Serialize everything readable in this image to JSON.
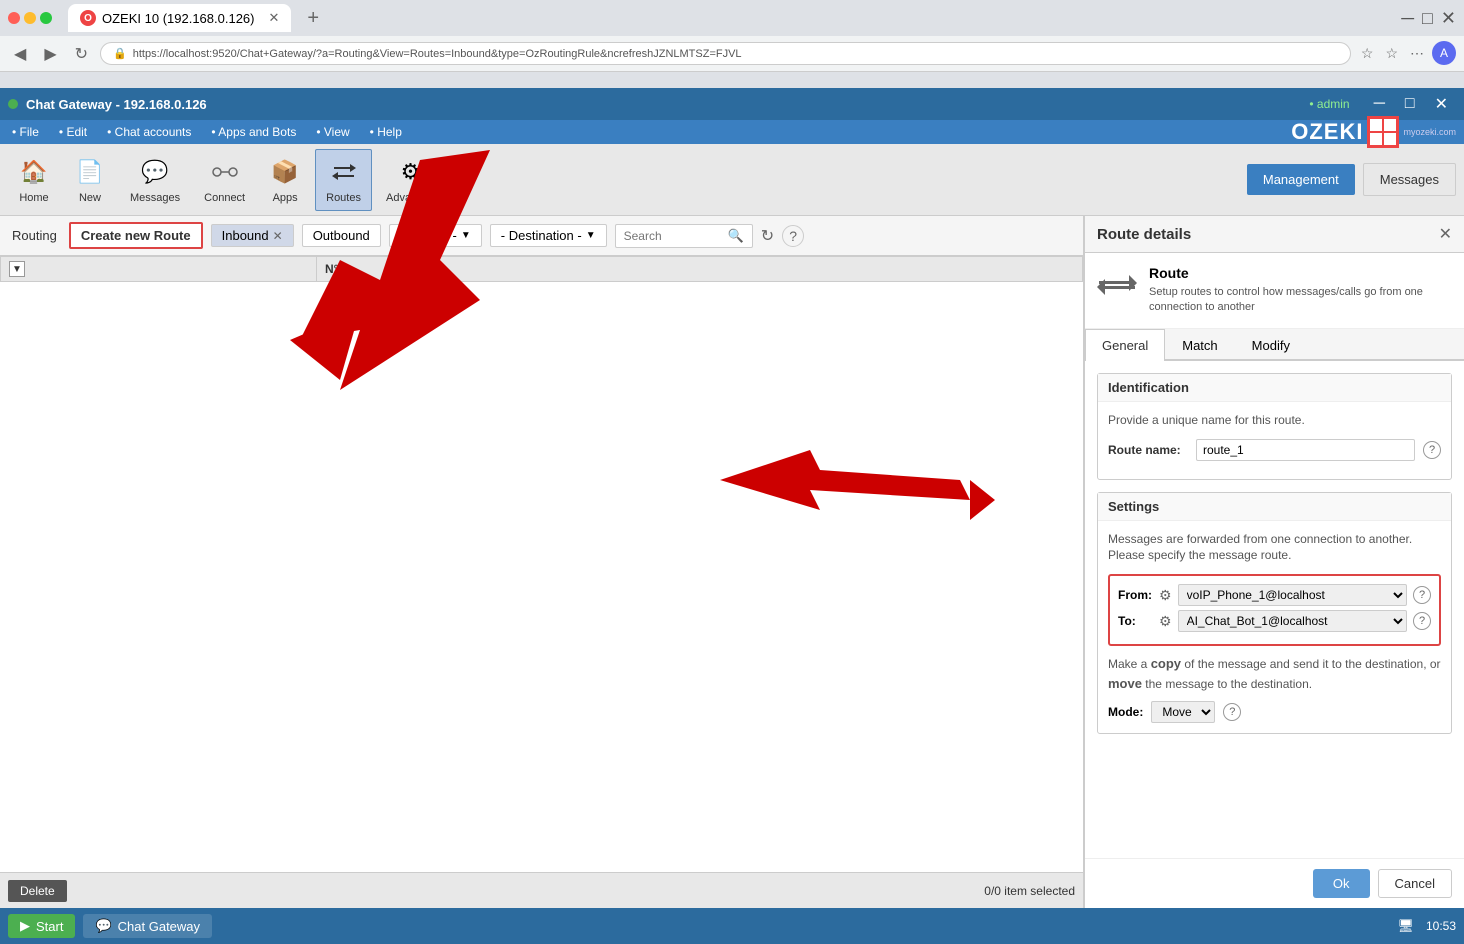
{
  "browser": {
    "tab_title": "OZEKI 10 (192.168.0.126)",
    "url": "https://localhost:9520/Chat+Gateway/?a=Routing&View=Routes=Inbound&type=OzRoutingRule&ncrefreshJZNLMTSZ=FJVL",
    "new_tab_label": "+"
  },
  "app": {
    "title": "Chat Gateway - 192.168.0.126",
    "title_dot_color": "#4caf50",
    "admin_label": "• admin"
  },
  "menubar": {
    "items": [
      "File",
      "Edit",
      "Chat accounts",
      "Apps and Bots",
      "View",
      "Help"
    ]
  },
  "toolbar": {
    "buttons": [
      {
        "label": "Home",
        "icon": "🏠"
      },
      {
        "label": "New",
        "icon": "📄"
      },
      {
        "label": "Messages",
        "icon": "💬"
      },
      {
        "label": "Connect",
        "icon": "🔗"
      },
      {
        "label": "Apps",
        "icon": "📦"
      },
      {
        "label": "Routes",
        "icon": "↔"
      },
      {
        "label": "Advanced",
        "icon": "⚙"
      }
    ],
    "active_button": "Routes",
    "management_label": "Management",
    "messages_label": "Messages"
  },
  "ozeki": {
    "logo_text": "OZEKI",
    "logo_sub": "myozeki.com"
  },
  "routing": {
    "label": "Routing",
    "create_route_label": "Create new Route",
    "inbound_label": "Inbound",
    "outbound_label": "Outbound",
    "source_label": "- Source -",
    "destination_label": "- Destination -",
    "search_placeholder": "Search",
    "table_headers": [
      "",
      "N°"
    ],
    "status_text": "0/0 item selected",
    "delete_label": "Delete"
  },
  "route_details": {
    "panel_title": "Route details",
    "route_icon": "↔",
    "route_title": "Route",
    "route_desc": "Setup routes to control how messages/calls go from one connection to another",
    "tabs": [
      "General",
      "Match",
      "Modify"
    ],
    "active_tab": "General",
    "identification": {
      "section_title": "Identification",
      "desc": "Provide a unique name for this route.",
      "route_name_label": "Route name:",
      "route_name_value": "route_1"
    },
    "settings": {
      "section_title": "Settings",
      "desc1": "Messages are forwarded from one connection to another. Please specify the message route.",
      "from_label": "From:",
      "from_value": "voIP_Phone_1@localhost",
      "to_label": "To:",
      "to_value": "AI_Chat_Bot_1@localhost",
      "from_options": [
        "voIP_Phone_1@localhost"
      ],
      "to_options": [
        "AI_Chat_Bot_1@localhost"
      ],
      "copy_move_text": "Make a copy of the message and send it to the destination, or move the message to the destination.",
      "mode_label": "Mode:",
      "mode_value": "Move",
      "mode_options": [
        "Move",
        "Copy"
      ]
    },
    "ok_label": "Ok",
    "cancel_label": "Cancel"
  },
  "taskbar": {
    "start_label": "Start",
    "app_label": "Chat Gateway",
    "time": "10:53"
  }
}
